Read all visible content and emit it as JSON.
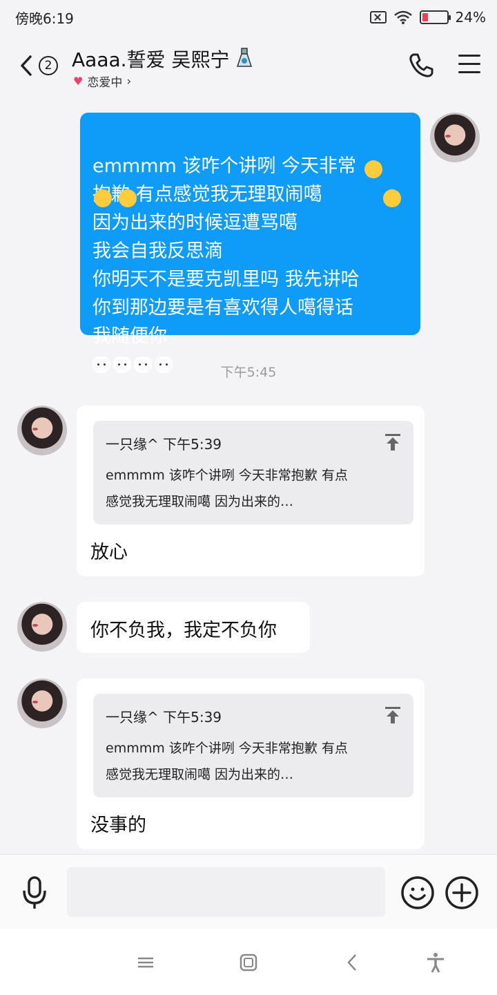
{
  "status_bar": {
    "time": "傍晚6:19",
    "battery": "24%"
  },
  "header": {
    "back_count": "2",
    "title": "Aaaa.誓爱 吴熙宁",
    "subtitle": "恋爱中",
    "subtitle_chevron": "›"
  },
  "messages": {
    "sent_1": "emmmm 该咋个讲咧 今天非常\n抱歉 有点感觉我无理取闹噶 \n因为出来的时候逗遭骂噶 \n我会自我反思滴\n你明天不是要克凯里吗 我先讲哈\n你到那边要是有喜欢得人噶得话\n我随便你",
    "timestamp": "下午5:45",
    "reply_1": {
      "quote_header": "一只缘^ 下午5:39",
      "quote_text": "emmmm 该咋个讲咧 今天非常抱歉 有点\n感觉我无理取闹噶 因为出来的…",
      "text": "放心"
    },
    "msg_2": "你不负我，我定不负你",
    "reply_2": {
      "quote_header": "一只缘^ 下午5:39",
      "quote_text": "emmmm 该咋个讲咧 今天非常抱歉 有点\n感觉我无理取闹噶 因为出来的…",
      "text": "没事的"
    }
  },
  "input": {
    "placeholder": ""
  },
  "colors": {
    "sent_bubble": "#0f9bf8",
    "background": "#f4f4f6"
  }
}
